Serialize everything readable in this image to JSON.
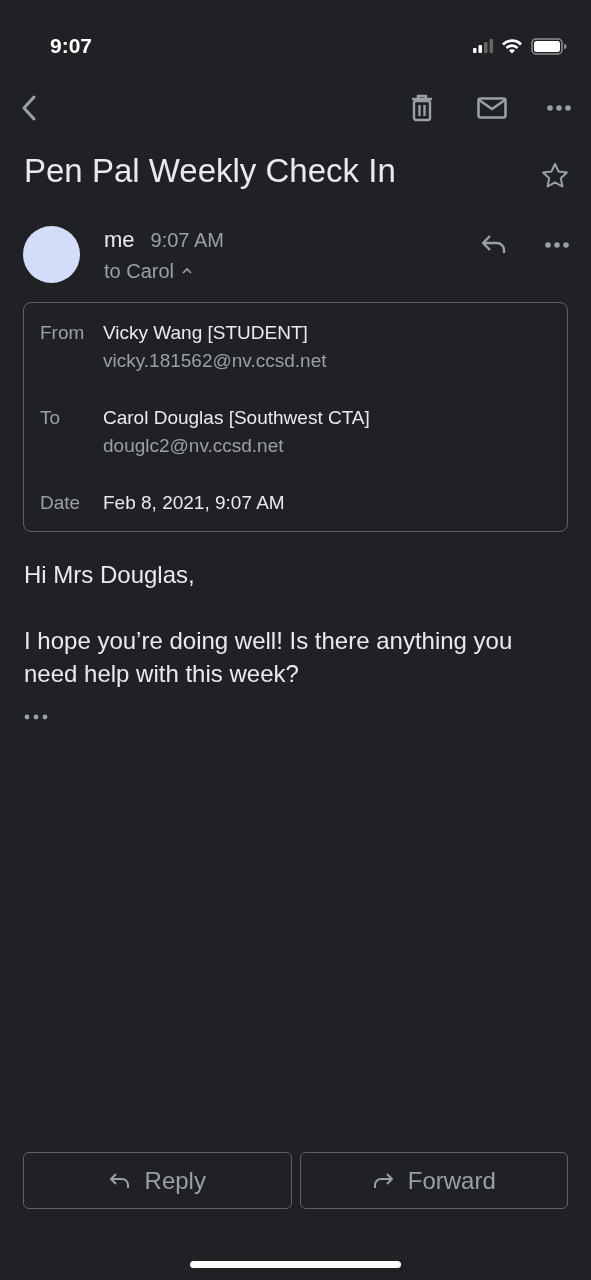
{
  "status_bar": {
    "time": "9:07"
  },
  "subject": "Pen Pal Weekly Check In",
  "starred": false,
  "message": {
    "sender": "me",
    "time": "9:07 AM",
    "recipients": "to Carol",
    "details_expanded": true,
    "details": [
      {
        "label": "From",
        "name": "Vicky Wang [STUDENT]",
        "email": "vicky.181562@nv.ccsd.net"
      },
      {
        "label": "To",
        "name": "Carol Douglas [Southwest CTA]",
        "email": "douglc2@nv.ccsd.net"
      },
      {
        "label": "Date",
        "name": "Feb 8, 2021, 9:07 AM"
      }
    ],
    "body": [
      "Hi Mrs Douglas,",
      "I hope you’re doing well! Is there anything you need help with this week?"
    ]
  },
  "actions": [
    {
      "label": "Reply",
      "kind": "reply"
    },
    {
      "label": "Forward",
      "kind": "forward"
    }
  ]
}
